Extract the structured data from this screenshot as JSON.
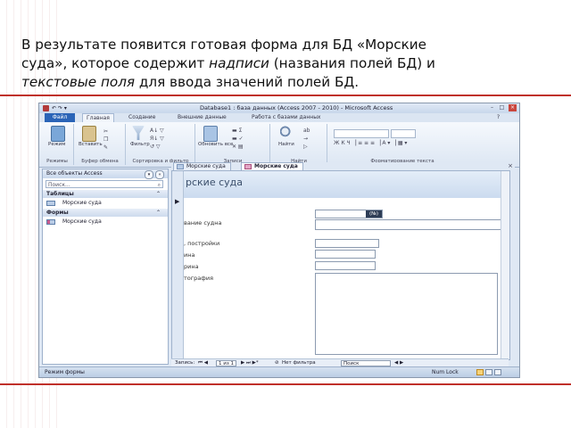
{
  "slide": {
    "line1": "В результате появится готовая форма для БД «Морские",
    "line2_a": "суда», которое содержит ",
    "line2_b": "надписи",
    "line2_c": " (названия полей БД) и",
    "line3_a": "текстовые поля",
    "line3_b": " для ввода значений полей БД."
  },
  "window": {
    "title": "Database1 : база данных (Access 2007 - 2010) - Microsoft Access",
    "minimize": "–",
    "maximize": "□",
    "close": "×"
  },
  "menu": {
    "file": "Файл",
    "items": [
      "Главная",
      "Создание",
      "Внешние данные",
      "Работа с базами данных"
    ]
  },
  "ribbon": {
    "groups": [
      {
        "label": "Режимы",
        "button": "Режим"
      },
      {
        "label": "Буфер обмена",
        "button": "Вставить"
      },
      {
        "label": "Сортировка и фильтр",
        "button": "Фильтр"
      },
      {
        "label": "Записи",
        "button": "Обновить все"
      },
      {
        "label": "Найти",
        "button": "Найти"
      },
      {
        "label": "Форматирование текста",
        "button": ""
      }
    ]
  },
  "nav": {
    "title": "Все объекты Access",
    "search_placeholder": "Поиск...",
    "categories": [
      {
        "label": "Таблицы",
        "items": [
          "Морские суда"
        ]
      },
      {
        "label": "Формы",
        "items": [
          "Морские суда"
        ]
      }
    ]
  },
  "tabs": [
    "Морские суда",
    "Морские суда"
  ],
  "form": {
    "header_title": "рские суда",
    "fields": [
      {
        "label": "вание судна",
        "value": "(№)"
      },
      {
        "label": ", постройки",
        "value": ""
      },
      {
        "label": "ина",
        "value": ""
      },
      {
        "label": "рина",
        "value": ""
      },
      {
        "label": "тография",
        "value": ""
      }
    ]
  },
  "record_nav": {
    "label": "Запись:",
    "position": "1 из 1",
    "filter": "Нет фильтра",
    "search": "Поиск"
  },
  "status": {
    "left": "Режим формы",
    "numlock": "Num Lock"
  },
  "colors": {
    "accent": "#2a64b7",
    "divider": "#c0302a"
  }
}
